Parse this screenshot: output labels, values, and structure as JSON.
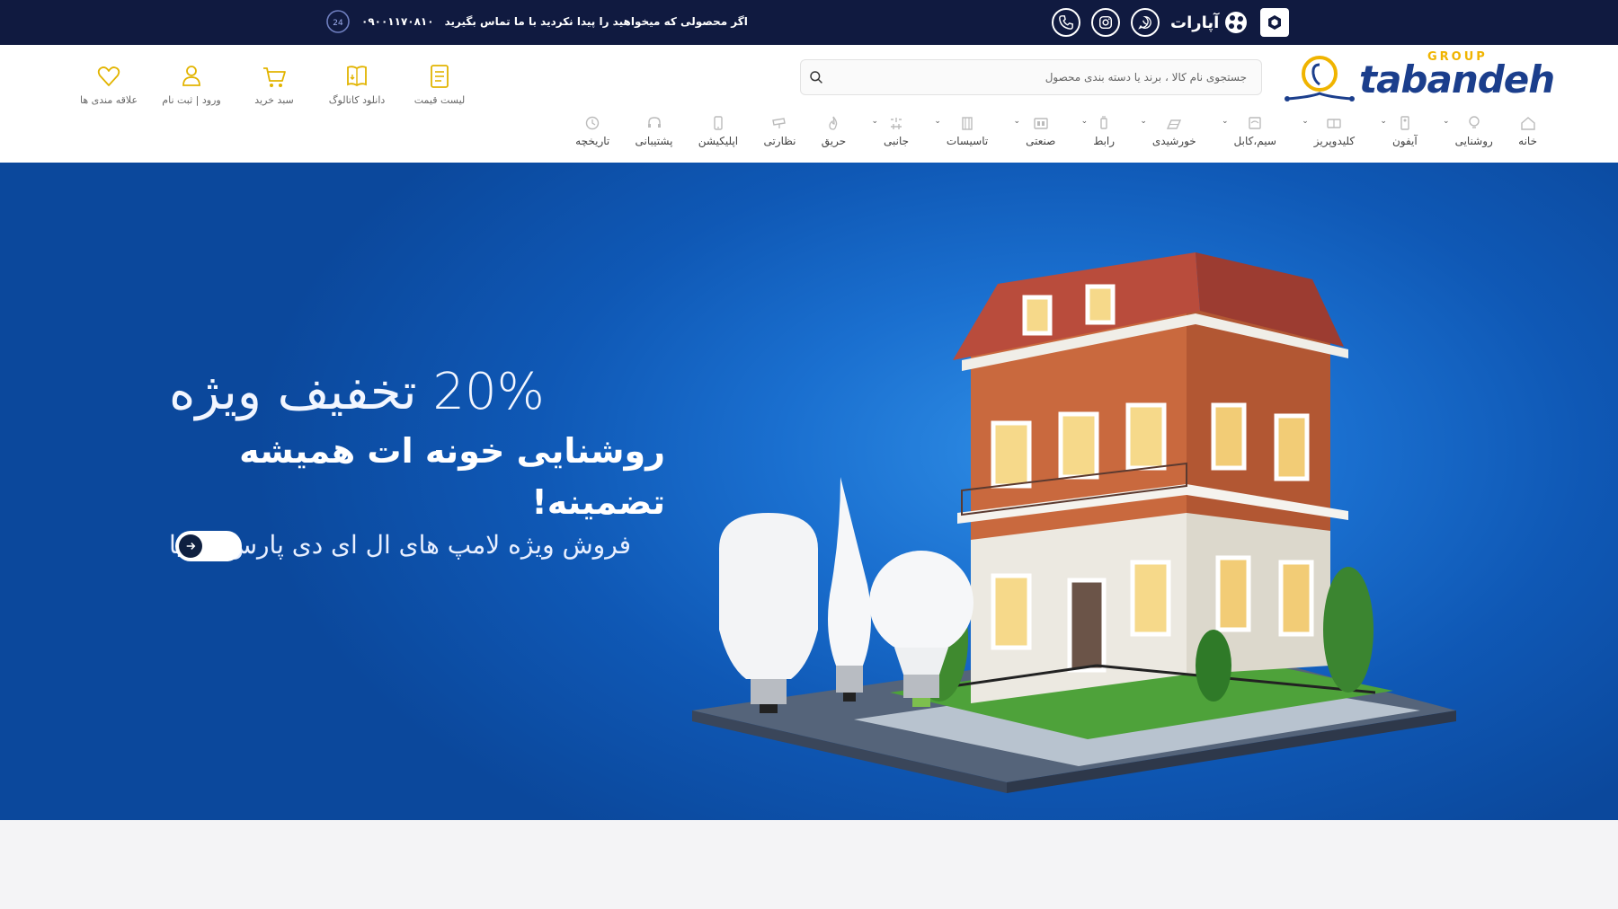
{
  "topbar": {
    "promo_text": "اگر محصولی که میخواهید را پیدا نکردید با ما تماس بگیرید",
    "phone": "۰۹۰۰۱۱۷۰۸۱۰",
    "aparat_label": "آپارات",
    "social_icons": [
      "support-24-icon",
      "phone-icon",
      "instagram-icon",
      "whatsapp-icon",
      "aparat-icon",
      "cube-app-icon"
    ]
  },
  "header": {
    "logo_word": "tabandeh",
    "logo_group": "GROUP",
    "search_placeholder": "جستجوی نام کالا ، برند یا دسته بندی محصول",
    "actions": [
      {
        "label": "لیست قیمت",
        "icon": "price-list-icon"
      },
      {
        "label": "دانلود کاتالوگ",
        "icon": "catalog-download-icon"
      },
      {
        "label": "سبد خرید",
        "icon": "cart-icon"
      },
      {
        "label": "ورود | ثبت نام",
        "icon": "user-icon"
      },
      {
        "label": "علاقه مندی ها",
        "icon": "heart-icon"
      }
    ]
  },
  "nav": [
    {
      "label": "خانه",
      "icon": "home-icon",
      "dropdown": false
    },
    {
      "label": "روشنایی",
      "icon": "bulb-icon",
      "dropdown": true
    },
    {
      "label": "آیفون",
      "icon": "intercom-icon",
      "dropdown": true
    },
    {
      "label": "کلیدوپریز",
      "icon": "socket-icon",
      "dropdown": true
    },
    {
      "label": "سیم،کابل",
      "icon": "cable-icon",
      "dropdown": true
    },
    {
      "label": "خورشیدی",
      "icon": "solar-icon",
      "dropdown": true
    },
    {
      "label": "رابط",
      "icon": "adapter-icon",
      "dropdown": true
    },
    {
      "label": "صنعتی",
      "icon": "industrial-icon",
      "dropdown": true
    },
    {
      "label": "تاسیسات",
      "icon": "facility-icon",
      "dropdown": true
    },
    {
      "label": "جانبی",
      "icon": "accessory-icon",
      "dropdown": true
    },
    {
      "label": "حریق",
      "icon": "fire-icon",
      "dropdown": false
    },
    {
      "label": "نظارتی",
      "icon": "camera-icon",
      "dropdown": false
    },
    {
      "label": "اپلیکیشن",
      "icon": "app-icon",
      "dropdown": false
    },
    {
      "label": "پشتیبانی",
      "icon": "support-icon",
      "dropdown": false
    },
    {
      "label": "تاریخچه",
      "icon": "history-icon",
      "dropdown": false
    }
  ],
  "hero": {
    "discount": "20% تخفیف ویژه",
    "title": "روشنایی خونه ات همیشه تضمینه!",
    "subtitle": "فروش ویژه لامپ های ال ای دی پارس کیمیا"
  },
  "colors": {
    "topbar": "#101a40",
    "brand_blue": "#1b3e8c",
    "accent_yellow": "#f0b400",
    "hero_blue": "#1a6fcf"
  }
}
